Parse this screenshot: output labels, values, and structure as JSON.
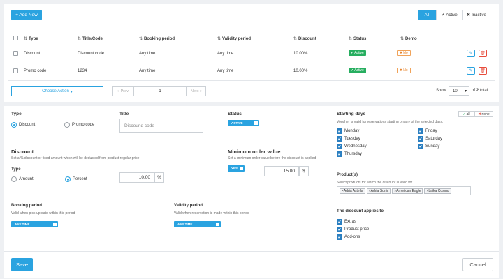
{
  "toolbar": {
    "add_new": "+ Add New",
    "filters": {
      "all": "All",
      "active": "Active",
      "inactive": "Inactive"
    }
  },
  "table": {
    "headers": [
      "Type",
      "Title/Code",
      "Booking period",
      "Validity period",
      "Discount",
      "Status",
      "Demo"
    ],
    "rows": [
      {
        "type": "Discount",
        "code": "Discount code",
        "booking": "Any time",
        "validity": "Any time",
        "discount": "10.00%",
        "status": "Active",
        "demo": "No"
      },
      {
        "type": "Promo code",
        "code": "1234",
        "booking": "Any time",
        "validity": "Any time",
        "discount": "10.00%",
        "status": "Active",
        "demo": "No"
      }
    ]
  },
  "pagination": {
    "choose_action": "Choose Action",
    "prev": "« Prev",
    "page": "1",
    "next": "Next »",
    "show_label": "Show",
    "per_page": "10",
    "of_label": "of",
    "total_pages": "2",
    "total_label": "total"
  },
  "form": {
    "type_label": "Type",
    "type_options": [
      "Discount",
      "Promo code"
    ],
    "title_label": "Title",
    "title_placeholder": "Discound code",
    "status_label": "Status",
    "status_value": "ACTIVE",
    "discount_label": "Discount",
    "discount_help": "Set a % discount or fixed amount which will be deducted from product regular price",
    "discount_type_label": "Type",
    "discount_type_options": [
      "Amount",
      "Percent"
    ],
    "discount_value": "10.00",
    "discount_unit": "%",
    "min_order_label": "Minimum order value",
    "min_order_help": "Set a minimum order value before the discount is applied",
    "min_order_toggle": "YES",
    "min_order_value": "15.00",
    "min_order_unit": "$",
    "booking_period_label": "Booking period",
    "booking_period_help": "Valid when pick-up date within this period",
    "booking_period_value": "ANY TIME",
    "validity_period_label": "Validity period",
    "validity_period_help": "Valid when reservation is made within this period",
    "validity_period_value": "ANY TIME",
    "starting_days_label": "Starting days",
    "starting_days_help": "Voucher is valid for reservations starting on any of the selected days.",
    "all_btn": "all",
    "none_btn": "none",
    "days_left": [
      "Monday",
      "Tuesday",
      "Wednesday",
      "Thursday"
    ],
    "days_right": [
      "Friday",
      "Saturday",
      "Sunday"
    ],
    "products_label": "Product(s)",
    "products_help": "Select products for which the discount is valid for.",
    "products": [
      "Adria Astella",
      "Adria Sonic",
      "American Eagle",
      "Laika Cosmo"
    ],
    "applies_label": "The discount applies to",
    "applies_items": [
      "Extras",
      "Product price",
      "Add-ons"
    ],
    "save": "Save",
    "cancel": "Cancel"
  },
  "colors": {
    "primary": "#2aa3e0",
    "success": "#27ae60",
    "danger": "#e74c3c",
    "warning": "#e67e22"
  }
}
